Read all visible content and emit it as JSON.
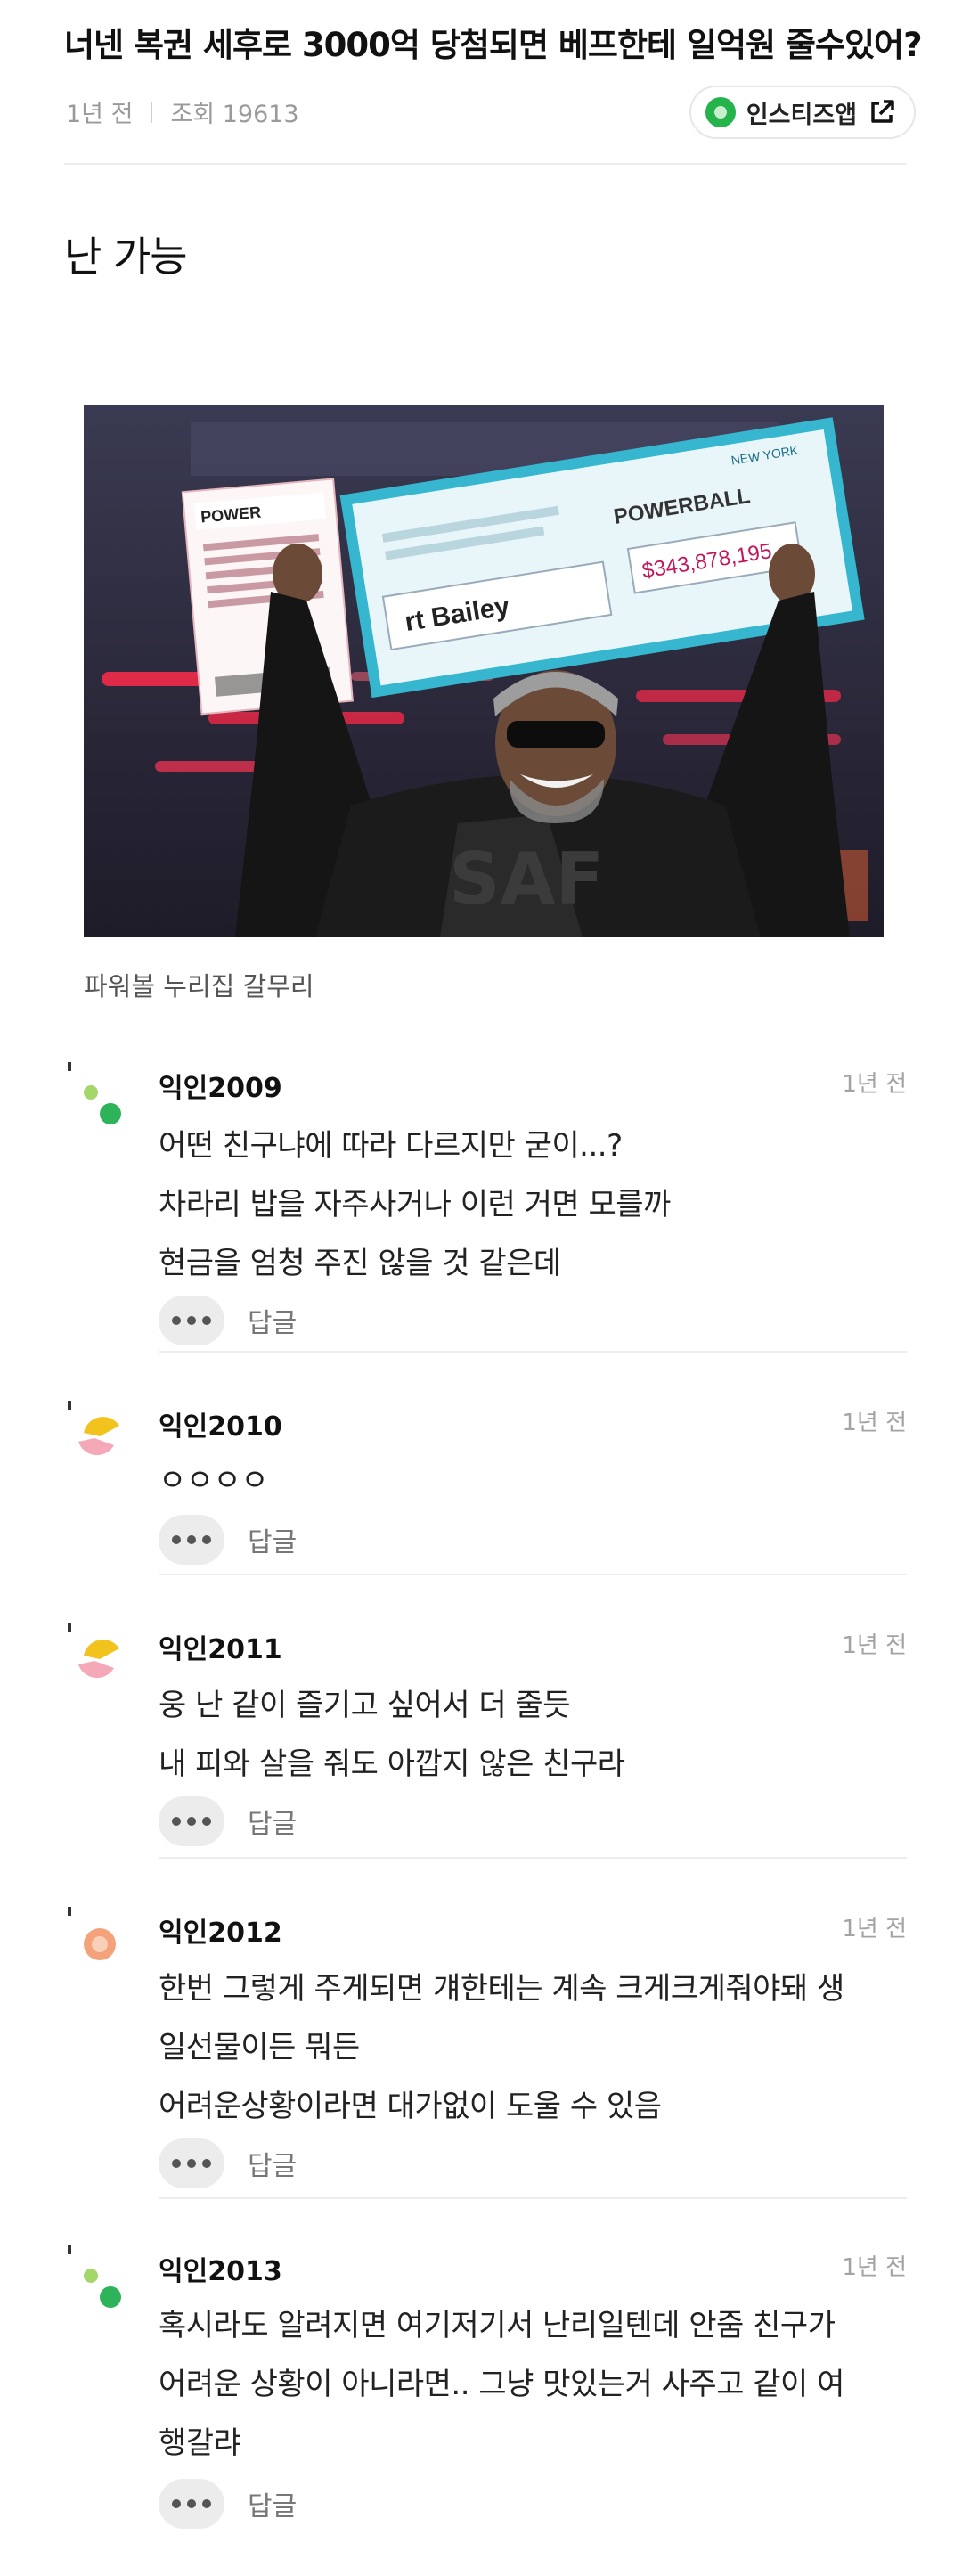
{
  "post": {
    "title": "너넨 복권 세후로 3000억 당첨되면 베프한테 일억원 줄수있어?",
    "age": "1년 전",
    "views": "조회 19613",
    "source_label": "인스티즈앱",
    "body": "난 가능",
    "image_caption": "파워볼 누리집 갈무리",
    "colors": {
      "brand_green": "#25b34b",
      "divider": "#ececec",
      "meta_gray": "#9a9a9a"
    }
  },
  "photo": {
    "check_amount": "$343,878,195",
    "check_payee": "rt Bailey",
    "brand": "POWERBALL",
    "state": "NEW YORK"
  },
  "comments": [
    {
      "author": "익인2009",
      "time": "1년 전",
      "avatar": "green-dots",
      "lines": [
        "어떤 친구냐에 따라 다르지만 굳이...?",
        "차라리 밥을 자주사거나 이런 거면 모를까",
        "현금을 엄청 주진 않을 것 같은데"
      ],
      "reply_label": "답글"
    },
    {
      "author": "익인2010",
      "time": "1년 전",
      "avatar": "yellow-pink",
      "lines": [
        "ㅇㅇㅇㅇ"
      ],
      "reply_label": "답글"
    },
    {
      "author": "익인2011",
      "time": "1년 전",
      "avatar": "yellow-pink",
      "lines": [
        "웅 난 같이 즐기고 싶어서 더 줄듯",
        "내 피와 살을 줘도 아깝지 않은 친구라"
      ],
      "reply_label": "답글"
    },
    {
      "author": "익인2012",
      "time": "1년 전",
      "avatar": "orange-ring",
      "lines": [
        "한번 그렇게 주게되면 걔한테는 계속 크게크게줘야돼 생",
        "일선물이든 뭐든",
        "어려운상황이라면 대가없이 도울 수 있음"
      ],
      "reply_label": "답글"
    },
    {
      "author": "익인2013",
      "time": "1년 전",
      "avatar": "green-dots",
      "lines": [
        "혹시라도 알려지면 여기저기서 난리일텐데 안줌 친구가",
        "어려운 상황이 아니라면.. 그냥 맛있는거 사주고 같이 여",
        "행갈랴"
      ],
      "reply_label": "답글"
    }
  ]
}
